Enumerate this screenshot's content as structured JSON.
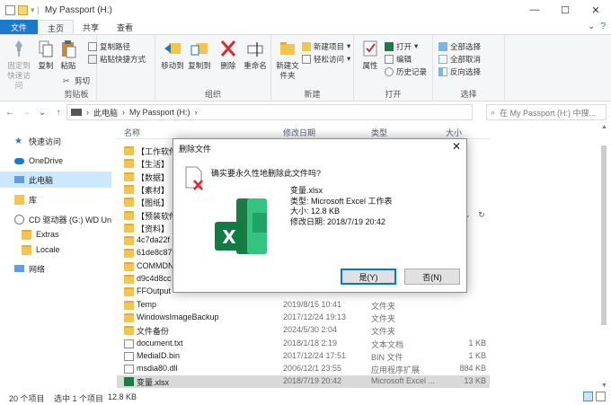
{
  "titlebar": {
    "title": "My Passport (H:)",
    "separator": "|",
    "minimize": "—",
    "maximize": "☐",
    "close": "✕"
  },
  "tabs": {
    "file": "文件",
    "home": "主页",
    "share": "共享",
    "view": "查看"
  },
  "ribbon": {
    "clipboard": {
      "label": "剪贴板",
      "pin": "固定到快速访问",
      "copy": "复制",
      "paste": "粘贴",
      "copy_path": "复制路径",
      "paste_shortcut": "粘贴快捷方式",
      "cut": "剪切"
    },
    "organize": {
      "label": "组织",
      "move_to": "移动到",
      "copy_to": "复制到",
      "delete": "删除",
      "rename": "重命名"
    },
    "new": {
      "label": "新建",
      "new_folder": "新建文件夹",
      "new_item": "新建项目",
      "easy_access": "轻松访问"
    },
    "open": {
      "label": "打开",
      "properties": "属性",
      "open": "打开",
      "edit": "编辑",
      "history": "历史记录"
    },
    "select": {
      "label": "选择",
      "select_all": "全部选择",
      "select_none": "全部取消",
      "invert": "反向选择"
    }
  },
  "address": {
    "path_root": "此电脑",
    "path_drive": "My Passport (H:)",
    "search_placeholder": "在 My Passport (H:) 中搜..."
  },
  "navpane": [
    {
      "label": "快速访问",
      "icon": "star-icon"
    },
    {
      "label": "OneDrive",
      "icon": "cloud-icon"
    },
    {
      "label": "此电脑",
      "icon": "computer-icon",
      "selected": true
    },
    {
      "label": "库",
      "icon": "library-icon"
    },
    {
      "label": "CD 驱动器 (G:) WD Unlo",
      "icon": "cd-drive-icon"
    },
    {
      "label": "Extras",
      "icon": "folder-icon"
    },
    {
      "label": "Locale",
      "icon": "folder-icon"
    },
    {
      "label": "网络",
      "icon": "network-icon"
    }
  ],
  "columns": {
    "name": "名称",
    "date": "修改日期",
    "type": "类型",
    "size": "大小"
  },
  "files": [
    {
      "name": "【工作软件",
      "date": "",
      "type": "",
      "size": "",
      "kind": "folder"
    },
    {
      "name": "【生活】",
      "date": "",
      "type": "",
      "size": "",
      "kind": "folder"
    },
    {
      "name": "【数据】",
      "date": "",
      "type": "",
      "size": "",
      "kind": "folder"
    },
    {
      "name": "【素材】",
      "date": "",
      "type": "",
      "size": "",
      "kind": "folder"
    },
    {
      "name": "【图纸】",
      "date": "",
      "type": "",
      "size": "",
      "kind": "folder"
    },
    {
      "name": "【预装软件",
      "date": "",
      "type": "",
      "size": "",
      "kind": "folder"
    },
    {
      "name": "【资料】",
      "date": "",
      "type": "",
      "size": "",
      "kind": "folder"
    },
    {
      "name": "4c7da22f",
      "date": "",
      "type": "",
      "size": "",
      "kind": "folder"
    },
    {
      "name": "61de8c87",
      "date": "",
      "type": "",
      "size": "",
      "kind": "folder"
    },
    {
      "name": "COMMDN",
      "date": "",
      "type": "",
      "size": "",
      "kind": "folder-special"
    },
    {
      "name": "d9c4d8cc",
      "date": "",
      "type": "",
      "size": "",
      "kind": "folder"
    },
    {
      "name": "FFOutput",
      "date": "",
      "type": "",
      "size": "",
      "kind": "folder"
    },
    {
      "name": "Temp",
      "date": "2019/8/15 10:41",
      "type": "文件夹",
      "size": "",
      "kind": "folder"
    },
    {
      "name": "WindowsImageBackup",
      "date": "2017/12/24 19:13",
      "type": "文件夹",
      "size": "",
      "kind": "folder"
    },
    {
      "name": "文件备份",
      "date": "2024/5/30 2:04",
      "type": "文件夹",
      "size": "",
      "kind": "folder"
    },
    {
      "name": "document.txt",
      "date": "2018/1/18 2:19",
      "type": "文本文档",
      "size": "1 KB",
      "kind": "doc"
    },
    {
      "name": "MediaID.bin",
      "date": "2017/12/24 17:51",
      "type": "BIN 文件",
      "size": "1 KB",
      "kind": "doc"
    },
    {
      "name": "msdia80.dll",
      "date": "2006/12/1 23:55",
      "type": "应用程序扩展",
      "size": "884 KB",
      "kind": "doc"
    },
    {
      "name": "变量.xlsx",
      "date": "2018/7/19 20:42",
      "type": "Microsoft Excel ...",
      "size": "13 KB",
      "kind": "xls",
      "selected": true
    }
  ],
  "status": {
    "count": "20 个项目",
    "selected": "选中 1 个项目",
    "size": "12.8 KB"
  },
  "dialog": {
    "title": "删除文件",
    "close": "✕",
    "question": "确实要永久性地删除此文件吗?",
    "file_name": "变量.xlsx",
    "type_line": "类型: Microsoft Excel 工作表",
    "size_line": "大小: 12.8 KB",
    "date_line": "修改日期: 2018/7/19 20:42",
    "yes": "是(Y)",
    "no": "否(N)"
  },
  "colors": {
    "accent": "#1979ca",
    "excel_green": "#1d7a45",
    "delete_red": "#d32f2f",
    "selection": "#cce8ff"
  }
}
